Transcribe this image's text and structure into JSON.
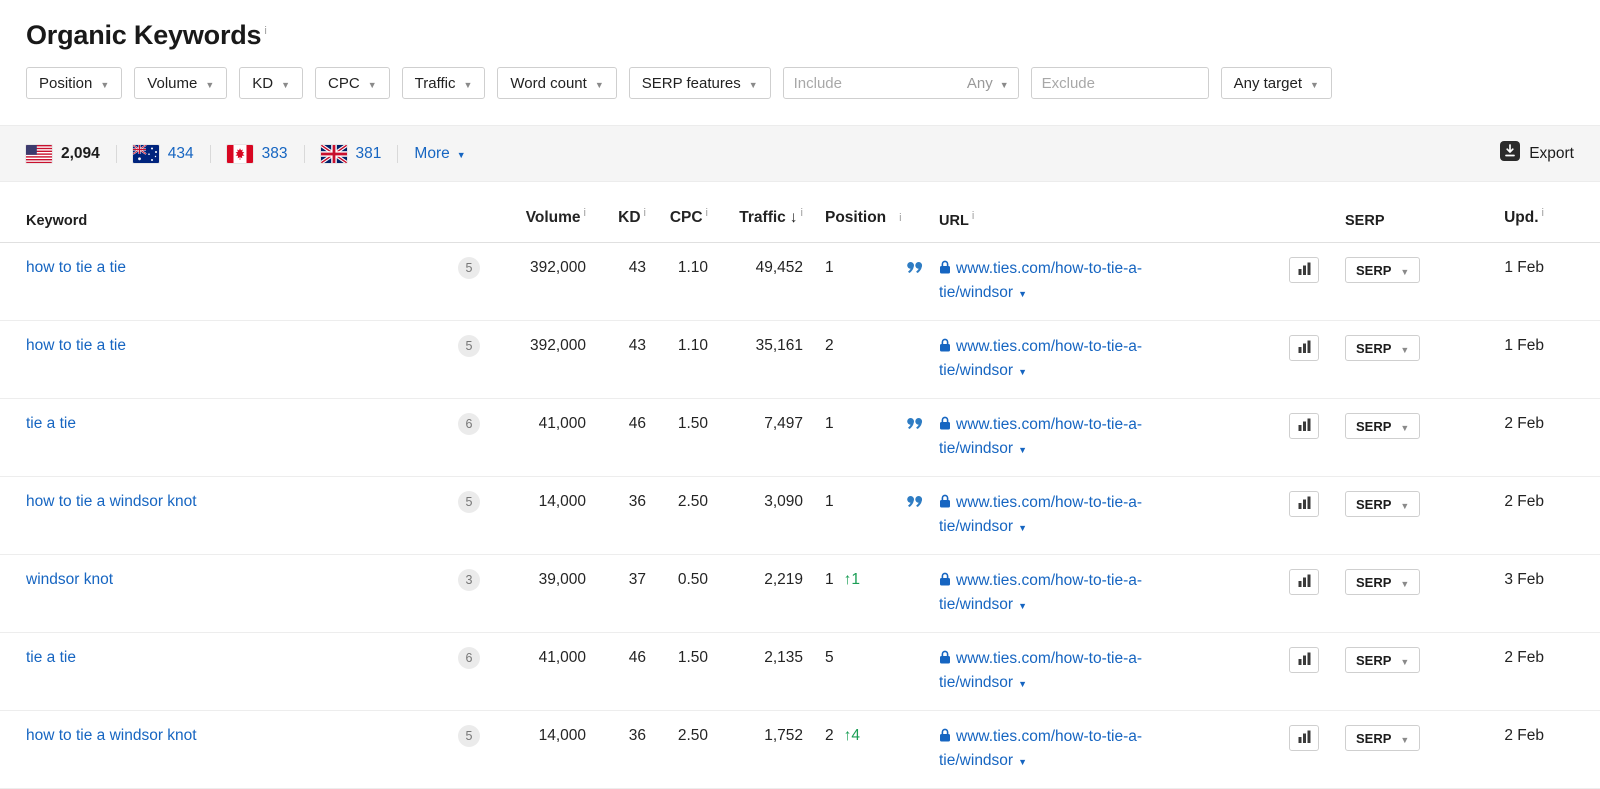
{
  "header": {
    "title": "Organic Keywords",
    "info": "i"
  },
  "filters": {
    "buttons": [
      "Position",
      "Volume",
      "KD",
      "CPC",
      "Traffic",
      "Word count",
      "SERP features"
    ],
    "include_placeholder": "Include",
    "include_mode": "Any",
    "exclude_placeholder": "Exclude",
    "target": "Any target"
  },
  "toolbar": {
    "countries": [
      {
        "name": "United States",
        "count": "2,094"
      },
      {
        "name": "Australia",
        "count": "434"
      },
      {
        "name": "Canada",
        "count": "383"
      },
      {
        "name": "United Kingdom",
        "count": "381"
      }
    ],
    "more": "More",
    "export": "Export"
  },
  "table": {
    "headers": {
      "keyword": "Keyword",
      "volume": "Volume",
      "kd": "KD",
      "cpc": "CPC",
      "traffic": "Traffic",
      "sort_indicator": "↓",
      "position": "Position",
      "url": "URL",
      "serp": "SERP",
      "upd": "Upd.",
      "info": "i"
    },
    "serp_button": "SERP",
    "rows": [
      {
        "keyword": "how to tie a tie",
        "words": "5",
        "volume": "392,000",
        "kd": "43",
        "cpc": "1.10",
        "traffic": "49,452",
        "position": "1",
        "change": "",
        "quote": true,
        "url_line1": "www.ties.com/how-to-tie-a-",
        "url_line2": "tie/windsor",
        "upd": "1 Feb"
      },
      {
        "keyword": "how to tie a tie",
        "words": "5",
        "volume": "392,000",
        "kd": "43",
        "cpc": "1.10",
        "traffic": "35,161",
        "position": "2",
        "change": "",
        "quote": false,
        "url_line1": "www.ties.com/how-to-tie-a-",
        "url_line2": "tie/windsor",
        "upd": "1 Feb"
      },
      {
        "keyword": "tie a tie",
        "words": "6",
        "volume": "41,000",
        "kd": "46",
        "cpc": "1.50",
        "traffic": "7,497",
        "position": "1",
        "change": "",
        "quote": true,
        "url_line1": "www.ties.com/how-to-tie-a-",
        "url_line2": "tie/windsor",
        "upd": "2 Feb"
      },
      {
        "keyword": "how to tie a windsor knot",
        "words": "5",
        "volume": "14,000",
        "kd": "36",
        "cpc": "2.50",
        "traffic": "3,090",
        "position": "1",
        "change": "",
        "quote": true,
        "url_line1": "www.ties.com/how-to-tie-a-",
        "url_line2": "tie/windsor",
        "upd": "2 Feb"
      },
      {
        "keyword": "windsor knot",
        "words": "3",
        "volume": "39,000",
        "kd": "37",
        "cpc": "0.50",
        "traffic": "2,219",
        "position": "1",
        "change": "↑1",
        "quote": false,
        "url_line1": "www.ties.com/how-to-tie-a-",
        "url_line2": "tie/windsor",
        "upd": "3 Feb"
      },
      {
        "keyword": "tie a tie",
        "words": "6",
        "volume": "41,000",
        "kd": "46",
        "cpc": "1.50",
        "traffic": "2,135",
        "position": "5",
        "change": "",
        "quote": false,
        "url_line1": "www.ties.com/how-to-tie-a-",
        "url_line2": "tie/windsor",
        "upd": "2 Feb"
      },
      {
        "keyword": "how to tie a windsor knot",
        "words": "5",
        "volume": "14,000",
        "kd": "36",
        "cpc": "2.50",
        "traffic": "1,752",
        "position": "2",
        "change": "↑4",
        "quote": false,
        "url_line1": "www.ties.com/how-to-tie-a-",
        "url_line2": "tie/windsor",
        "upd": "2 Feb"
      }
    ]
  }
}
